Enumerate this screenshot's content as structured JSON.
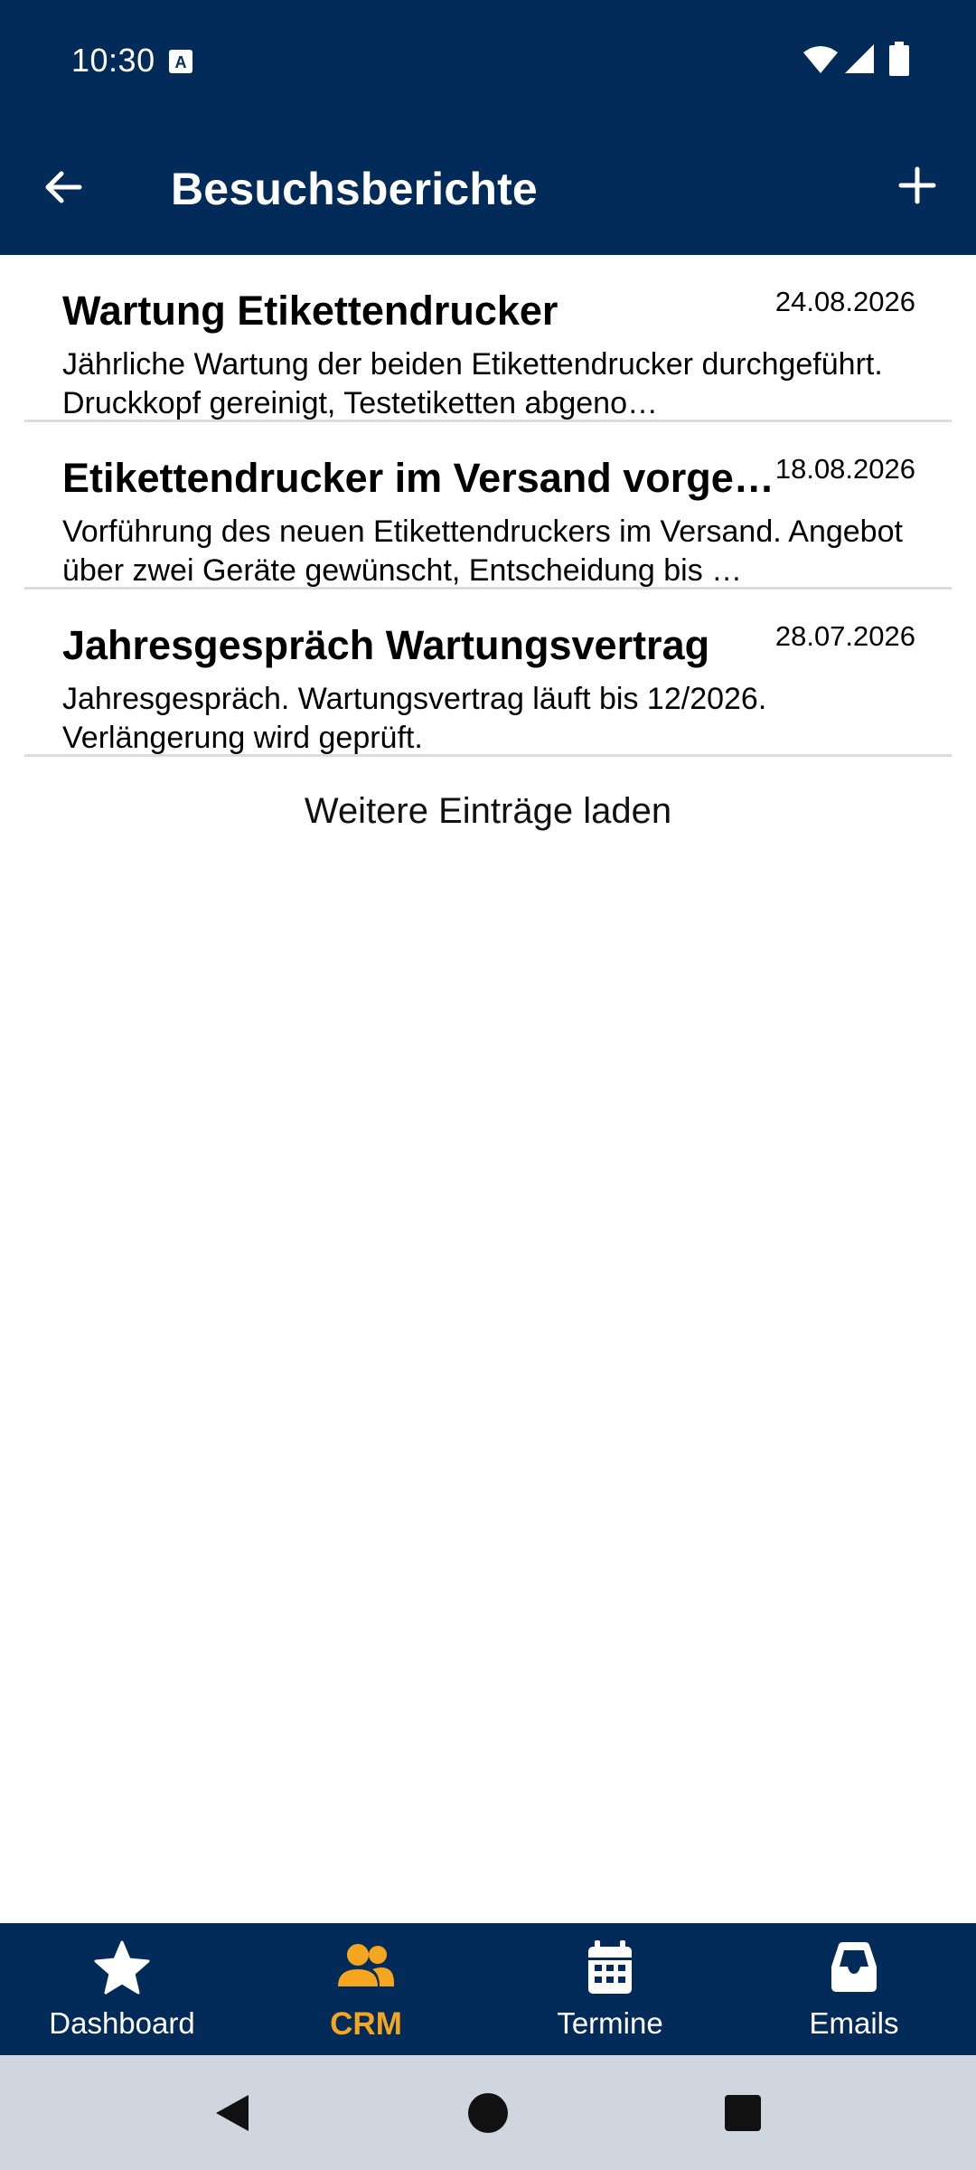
{
  "status_bar": {
    "time": "10:30"
  },
  "app_bar": {
    "title": "Besuchsberichte",
    "back_icon": "arrow-left-icon",
    "add_icon": "plus-icon"
  },
  "reports": [
    {
      "title": "Wartung Etikettendrucker",
      "date": "24.08.2026",
      "text": "Jährliche Wartung der beiden Etikettendrucker durchgeführt. Druckkopf gereinigt, Testetiketten abgeno…"
    },
    {
      "title": "Etikettendrucker im Versand vorge…",
      "date": "18.08.2026",
      "text": "Vorführung des neuen Etikettendruckers im Versand. Angebot über zwei Geräte gewünscht, Entscheidung bis …"
    },
    {
      "title": "Jahresgespräch Wartungsvertrag",
      "date": "28.07.2026",
      "text": "Jahresgespräch. Wartungsvertrag läuft bis 12/2026. Verlängerung wird geprüft."
    }
  ],
  "load_more_label": "Weitere Einträge laden",
  "bottom_nav": [
    {
      "label": "Dashboard",
      "icon": "star-icon",
      "active": false
    },
    {
      "label": "CRM",
      "icon": "people-icon",
      "active": true
    },
    {
      "label": "Termine",
      "icon": "calendar-icon",
      "active": false
    },
    {
      "label": "Emails",
      "icon": "inbox-icon",
      "active": false
    }
  ],
  "colors": {
    "primary": "#022b59",
    "accent": "#f4a620",
    "system_nav": "#cfd6df"
  }
}
